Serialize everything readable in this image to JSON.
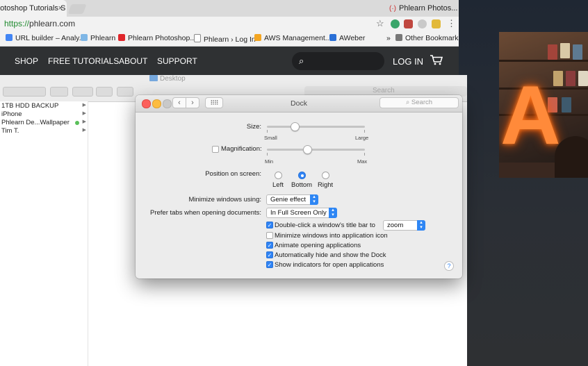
{
  "browser": {
    "active_tab": "hotoshop Tutorials S",
    "tab_close": "×",
    "right_tab": "Phlearn Photos...",
    "url_scheme": "https://",
    "url_host": "phlearn.com",
    "star_icon": "☆",
    "menu_icon": "⋮",
    "bookmarks": [
      {
        "label": "URL builder – Analy...",
        "color": "#4285f4"
      },
      {
        "label": "Phlearn",
        "color": "#7fb7e6"
      },
      {
        "label": "Phlearn Photoshop...",
        "color": "#e0262b"
      },
      {
        "label": "Phlearn › Log In",
        "color": "#ffffff"
      },
      {
        "label": "AWS Management...",
        "color": "#f4a622"
      },
      {
        "label": "AWeber",
        "color": "#2a6fd6"
      }
    ],
    "bookmarks_more": "»",
    "other_bookmarks": "Other Bookmarks"
  },
  "site_nav": {
    "links": [
      "SHOP",
      "FREE TUTORIALS",
      "ABOUT",
      "SUPPORT"
    ],
    "login": "LOG IN",
    "search_icon": "⌕",
    "cart_icon": "🛒"
  },
  "finder": {
    "title": "Desktop",
    "search_placeholder": "Search",
    "sidebar": [
      {
        "label": "1TB HDD BACKUP",
        "dot": false
      },
      {
        "label": "iPhone",
        "dot": false
      },
      {
        "label": "Phlearn De...Wallpaper",
        "dot": true
      },
      {
        "label": "Tim T.",
        "dot": false
      }
    ],
    "arrow": "▶"
  },
  "dock": {
    "title": "Dock",
    "search_placeholder": "Search",
    "back": "‹",
    "forward": "›",
    "grid": "⠿⠿",
    "size": {
      "label": "Size:",
      "min": "Small",
      "max": "Large",
      "value": 0.28
    },
    "magnification": {
      "label": "Magnification:",
      "checked": false,
      "min": "Min",
      "max": "Max",
      "value": 0.41
    },
    "position": {
      "label": "Position on screen:",
      "options": [
        "Left",
        "Bottom",
        "Right"
      ],
      "selected": "Bottom"
    },
    "minimize": {
      "label": "Minimize windows using:",
      "value": "Genie effect"
    },
    "prefer_tabs": {
      "label": "Prefer tabs when opening documents:",
      "value": "In Full Screen Only"
    },
    "options": [
      {
        "label": "Double-click a window's title bar to",
        "checked": true
      },
      {
        "label": "Minimize windows into application icon",
        "checked": false
      },
      {
        "label": "Animate opening applications",
        "checked": true
      },
      {
        "label": "Automatically hide and show the Dock",
        "checked": true
      },
      {
        "label": "Show indicators for open applications",
        "checked": true
      }
    ],
    "double_click_action": "zoom",
    "check_mark": "✓",
    "help": "?"
  },
  "colors": {
    "accent": "#2f83f5",
    "nav_bg": "#2f3133"
  }
}
